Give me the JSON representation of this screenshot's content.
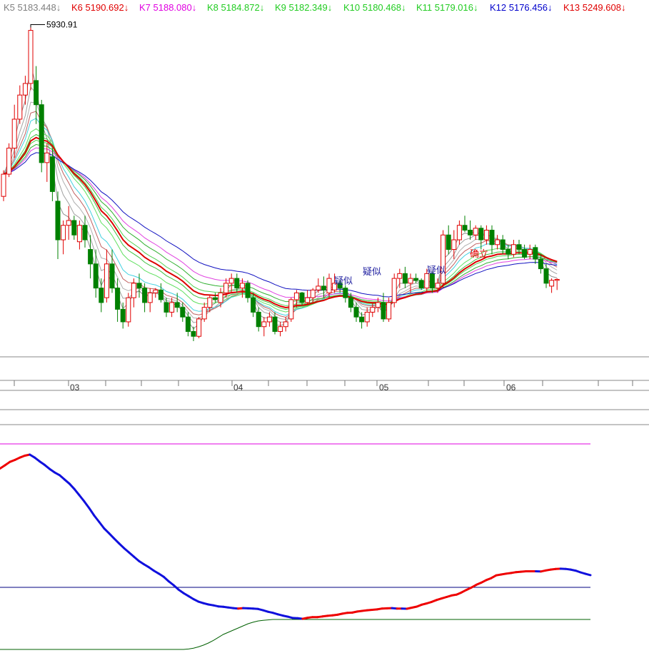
{
  "chart_data": {
    "type": "candlestick",
    "legend": [
      {
        "name": "K5",
        "value": "5183.448",
        "arrow": "↓",
        "color": "#808080"
      },
      {
        "name": "K6",
        "value": "5190.692",
        "arrow": "↓",
        "color": "#e00000"
      },
      {
        "name": "K7",
        "value": "5188.080",
        "arrow": "↓",
        "color": "#e000e0"
      },
      {
        "name": "K8",
        "value": "5184.872",
        "arrow": "↓",
        "color": "#22cc22"
      },
      {
        "name": "K9",
        "value": "5182.349",
        "arrow": "↓",
        "color": "#22cc22"
      },
      {
        "name": "K10",
        "value": "5180.468",
        "arrow": "↓",
        "color": "#22cc22"
      },
      {
        "name": "K11",
        "value": "5179.016",
        "arrow": "↓",
        "color": "#22cc22"
      },
      {
        "name": "K12",
        "value": "5176.456",
        "arrow": "↓",
        "color": "#0000cc"
      },
      {
        "name": "K13",
        "value": "5249.608",
        "arrow": "↓",
        "color": "#e00000"
      }
    ],
    "peak_label": "5930.91",
    "x_ticks": [
      "03",
      "04",
      "05",
      "06"
    ],
    "signal_labels": [
      "疑似",
      "疑似",
      "疑似",
      "确立"
    ],
    "price_range": [
      2650,
      6000
    ],
    "candles": [
      [
        4150,
        4420,
        4100,
        4380
      ],
      [
        4380,
        4700,
        4350,
        4650
      ],
      [
        4650,
        5100,
        4550,
        4950
      ],
      [
        4950,
        5300,
        4900,
        5200
      ],
      [
        5200,
        5400,
        5100,
        5320
      ],
      [
        5320,
        5930,
        5250,
        5870
      ],
      [
        5350,
        5500,
        4900,
        5100
      ],
      [
        5100,
        5150,
        4400,
        4500
      ],
      [
        4500,
        4700,
        4300,
        4600
      ],
      [
        4560,
        4650,
        4100,
        4200
      ],
      [
        4100,
        4200,
        3500,
        3700
      ],
      [
        3700,
        3900,
        3550,
        3850
      ],
      [
        3850,
        4050,
        3700,
        3900
      ],
      [
        3900,
        3950,
        3700,
        3750
      ],
      [
        3680,
        3900,
        3600,
        3850
      ],
      [
        3850,
        3950,
        3620,
        3700
      ],
      [
        3600,
        3750,
        3300,
        3450
      ],
      [
        3450,
        3600,
        3100,
        3200
      ],
      [
        3200,
        3300,
        2950,
        3050
      ],
      [
        3100,
        3600,
        3050,
        3450
      ],
      [
        3450,
        3600,
        3150,
        3200
      ],
      [
        3200,
        3300,
        2850,
        2980
      ],
      [
        2980,
        3050,
        2780,
        2850
      ],
      [
        2850,
        3150,
        2800,
        3100
      ],
      [
        3100,
        3300,
        3000,
        3250
      ],
      [
        3250,
        3350,
        3100,
        3200
      ],
      [
        3200,
        3250,
        2950,
        3050
      ],
      [
        3050,
        3200,
        2950,
        3150
      ],
      [
        3150,
        3200,
        3100,
        3180
      ],
      [
        3180,
        3250,
        3050,
        3080
      ],
      [
        3050,
        3100,
        2900,
        2950
      ],
      [
        2950,
        3100,
        2900,
        3050
      ],
      [
        3050,
        3150,
        2950,
        3000
      ],
      [
        3000,
        3050,
        2850,
        2900
      ],
      [
        2900,
        2950,
        2700,
        2750
      ],
      [
        2750,
        2800,
        2650,
        2700
      ],
      [
        2700,
        2900,
        2680,
        2880
      ],
      [
        2880,
        3050,
        2850,
        3000
      ],
      [
        3000,
        3120,
        2950,
        3100
      ],
      [
        3100,
        3150,
        3050,
        3080
      ],
      [
        3050,
        3200,
        3000,
        3150
      ],
      [
        3150,
        3300,
        3100,
        3250
      ],
      [
        3250,
        3350,
        3150,
        3300
      ],
      [
        3300,
        3350,
        3150,
        3200
      ],
      [
        3200,
        3300,
        3100,
        3250
      ],
      [
        3250,
        3280,
        3050,
        3100
      ],
      [
        3100,
        3150,
        2900,
        2950
      ],
      [
        2950,
        3000,
        2750,
        2800
      ],
      [
        2800,
        2900,
        2700,
        2850
      ],
      [
        2850,
        2950,
        2800,
        2900
      ],
      [
        2900,
        2950,
        2720,
        2750
      ],
      [
        2750,
        2850,
        2700,
        2800
      ],
      [
        2800,
        2900,
        2750,
        2850
      ],
      [
        2880,
        3100,
        2850,
        3080
      ],
      [
        3080,
        3180,
        3000,
        3150
      ],
      [
        3150,
        3160,
        3020,
        3050
      ],
      [
        3050,
        3180,
        3030,
        3100
      ],
      [
        3100,
        3200,
        3050,
        3180
      ],
      [
        3180,
        3300,
        3150,
        3220
      ],
      [
        3220,
        3320,
        3100,
        3180
      ],
      [
        3150,
        3350,
        3100,
        3300
      ],
      [
        3180,
        3350,
        3150,
        3250
      ],
      [
        3250,
        3280,
        3150,
        3200
      ],
      [
        3200,
        3230,
        3050,
        3100
      ],
      [
        3100,
        3150,
        2950,
        3000
      ],
      [
        3000,
        3050,
        2850,
        2900
      ],
      [
        2900,
        2950,
        2780,
        2850
      ],
      [
        2850,
        3000,
        2800,
        2950
      ],
      [
        2950,
        3050,
        2900,
        3000
      ],
      [
        3000,
        3100,
        2950,
        3050
      ],
      [
        3050,
        3150,
        2850,
        2880
      ],
      [
        2880,
        3100,
        2850,
        3050
      ],
      [
        3050,
        3350,
        3000,
        3300
      ],
      [
        3300,
        3400,
        3200,
        3350
      ],
      [
        3350,
        3420,
        3200,
        3250
      ],
      [
        3250,
        3350,
        3150,
        3300
      ],
      [
        3300,
        3350,
        3250,
        3280
      ],
      [
        3280,
        3300,
        3180,
        3200
      ],
      [
        3200,
        3400,
        3150,
        3350
      ],
      [
        3350,
        3380,
        3150,
        3200
      ],
      [
        3200,
        3300,
        3150,
        3250
      ],
      [
        3250,
        3800,
        3200,
        3750
      ],
      [
        3750,
        3850,
        3550,
        3600
      ],
      [
        3600,
        3800,
        3500,
        3700
      ],
      [
        3700,
        3900,
        3650,
        3850
      ],
      [
        3850,
        3950,
        3780,
        3800
      ],
      [
        3800,
        3900,
        3700,
        3750
      ],
      [
        3750,
        3850,
        3700,
        3820
      ],
      [
        3820,
        3850,
        3600,
        3700
      ],
      [
        3700,
        3850,
        3650,
        3800
      ],
      [
        3800,
        3850,
        3550,
        3650
      ],
      [
        3650,
        3750,
        3600,
        3700
      ],
      [
        3700,
        3750,
        3550,
        3600
      ],
      [
        3600,
        3650,
        3500,
        3550
      ],
      [
        3550,
        3700,
        3520,
        3650
      ],
      [
        3650,
        3700,
        3550,
        3600
      ],
      [
        3600,
        3650,
        3500,
        3520
      ],
      [
        3550,
        3650,
        3500,
        3600
      ],
      [
        3620,
        3650,
        3450,
        3500
      ],
      [
        3500,
        3550,
        3350,
        3400
      ],
      [
        3400,
        3450,
        3200,
        3250
      ],
      [
        3220,
        3300,
        3150,
        3280
      ],
      [
        3280,
        3300,
        3180,
        3290
      ]
    ],
    "oscillator": [
      0.845,
      0.86,
      0.876,
      0.885,
      0.896,
      0.905,
      0.91,
      0.896,
      0.878,
      0.862,
      0.843,
      0.827,
      0.814,
      0.794,
      0.774,
      0.749,
      0.72,
      0.691,
      0.659,
      0.625,
      0.595,
      0.565,
      0.542,
      0.518,
      0.495,
      0.473,
      0.453,
      0.433,
      0.413,
      0.398,
      0.384,
      0.368,
      0.354,
      0.339,
      0.318,
      0.3,
      0.279,
      0.263,
      0.249,
      0.235,
      0.223,
      0.216,
      0.21,
      0.206,
      0.201,
      0.199,
      0.196,
      0.193,
      0.191,
      0.193,
      0.192,
      0.191,
      0.189,
      0.183,
      0.176,
      0.171,
      0.164,
      0.158,
      0.153,
      0.147,
      0.146,
      0.143,
      0.148,
      0.151,
      0.151,
      0.154,
      0.157,
      0.159,
      0.162,
      0.167,
      0.171,
      0.172,
      0.177,
      0.18,
      0.183,
      0.185,
      0.187,
      0.191,
      0.192,
      0.193,
      0.191,
      0.191,
      0.19,
      0.195,
      0.2,
      0.209,
      0.215,
      0.222,
      0.231,
      0.238,
      0.245,
      0.252,
      0.256,
      0.266,
      0.278,
      0.289,
      0.302,
      0.312,
      0.324,
      0.333,
      0.346,
      0.35,
      0.354,
      0.357,
      0.361,
      0.363,
      0.365,
      0.365,
      0.365,
      0.364,
      0.369,
      0.373,
      0.376,
      0.377,
      0.376,
      0.373,
      0.368,
      0.36,
      0.353,
      0.347
    ],
    "oscillator_signal": [
      0,
      0,
      0,
      0,
      0,
      0,
      0,
      0,
      0,
      0,
      0,
      0,
      0,
      0,
      0,
      0,
      0,
      0,
      0,
      0,
      0,
      0,
      0,
      0,
      0,
      0,
      0,
      0,
      0,
      0,
      0,
      0,
      0,
      0,
      0,
      0,
      0,
      0,
      0.002,
      0.006,
      0.012,
      0.02,
      0.03,
      0.042,
      0.056,
      0.07,
      0.08,
      0.09,
      0.1,
      0.11,
      0.12,
      0.127,
      0.133,
      0.136,
      0.138,
      0.14,
      0.14,
      0.14,
      0.14,
      0.14,
      0.14,
      0.14,
      0.14,
      0.14,
      0.14,
      0.14,
      0.14,
      0.14,
      0.14,
      0.14,
      0.14,
      0.14,
      0.14,
      0.14,
      0.14,
      0.14,
      0.14,
      0.14,
      0.14,
      0.14,
      0.14,
      0.14,
      0.14,
      0.14,
      0.14,
      0.14,
      0.14,
      0.14,
      0.14,
      0.14,
      0.14,
      0.14,
      0.14,
      0.14,
      0.14,
      0.14,
      0.14,
      0.14,
      0.14,
      0.14,
      0.14,
      0.14,
      0.14,
      0.14,
      0.14,
      0.14,
      0.14,
      0.14,
      0.14,
      0.14,
      0.14,
      0.14,
      0.14,
      0.14,
      0.14,
      0.14,
      0.14,
      0.14,
      0.14,
      0.14
    ],
    "osc_range": [
      0,
      1
    ]
  }
}
